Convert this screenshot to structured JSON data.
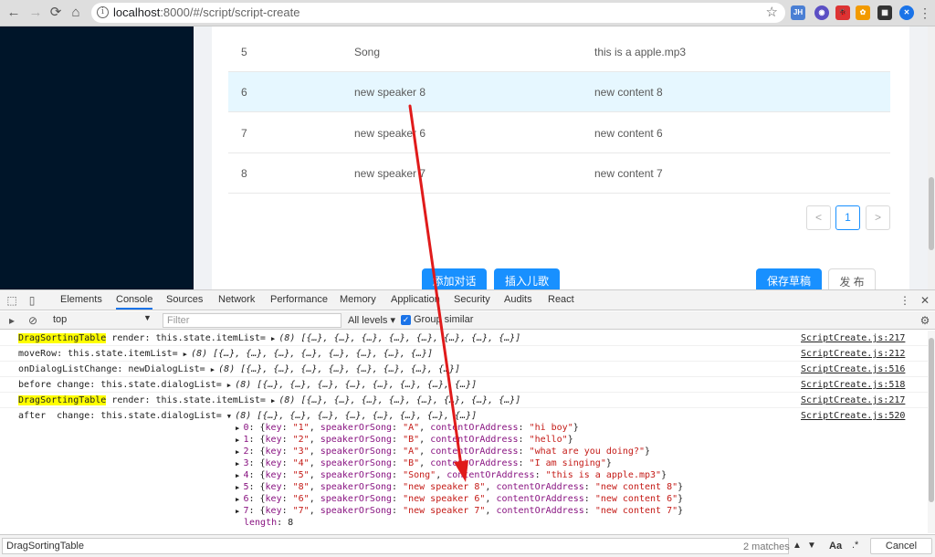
{
  "browser": {
    "back": "←",
    "forward": "→",
    "reload": "⟳",
    "home": "⌂",
    "info": "i",
    "url_host": "localhost",
    "url_rest": ":8000/#/script/script-create",
    "star": "☆",
    "extensions": [
      "JH",
      "◉",
      "🐞",
      "✿",
      "▦",
      "✕"
    ]
  },
  "table": {
    "rows": [
      {
        "key": "5",
        "speaker": "Song",
        "content": "this is a apple.mp3"
      },
      {
        "key": "6",
        "speaker": "new speaker 8",
        "content": "new content 8"
      },
      {
        "key": "7",
        "speaker": "new speaker 6",
        "content": "new content 6"
      },
      {
        "key": "8",
        "speaker": "new speaker 7",
        "content": "new content 7"
      }
    ],
    "pager_prev": "<",
    "pager_page": "1",
    "pager_next": ">"
  },
  "actions": {
    "add_dialog": "添加对话",
    "insert_song": "插入儿歌",
    "save_draft": "保存草稿",
    "publish": "发 布"
  },
  "devtools": {
    "tabs": [
      "Elements",
      "Console",
      "Sources",
      "Network",
      "Performance",
      "Memory",
      "Application",
      "Security",
      "Audits",
      "React"
    ],
    "context": "top",
    "filter_placeholder": "Filter",
    "levels": "All levels",
    "group_similar": "Group similar",
    "logs": [
      {
        "hl": "DragSortingTable",
        "text": " render: this.state.itemList= ",
        "arr": "(8) [{…}, {…}, {…}, {…}, {…}, {…}, {…}, {…}]",
        "src": "ScriptCreate.js:217"
      },
      {
        "hl": "",
        "text": "moveRow: this.state.itemList= ",
        "arr": "(8) [{…}, {…}, {…}, {…}, {…}, {…}, {…}, {…}]",
        "src": "ScriptCreate.js:212"
      },
      {
        "hl": "",
        "text": "onDialogListChange: newDialogList= ",
        "arr": "(8) [{…}, {…}, {…}, {…}, {…}, {…}, {…}, {…}]",
        "src": "ScriptCreate.js:516"
      },
      {
        "hl": "",
        "text": "before change: this.state.dialogList= ",
        "arr": "(8) [{…}, {…}, {…}, {…}, {…}, {…}, {…}, {…}]",
        "src": "ScriptCreate.js:518"
      },
      {
        "hl": "DragSortingTable",
        "text": " render: this.state.itemList= ",
        "arr": "(8) [{…}, {…}, {…}, {…}, {…}, {…}, {…}, {…}]",
        "src": "ScriptCreate.js:217"
      },
      {
        "hl": "",
        "text": "after  change: this.state.dialogList= ",
        "arr": "(8) [{…}, {…}, {…}, {…}, {…}, {…}, {…}, {…}]",
        "src": "ScriptCreate.js:520"
      }
    ],
    "items": [
      {
        "i": "0",
        "key": "\"1\"",
        "sp": "\"A\"",
        "ct": "\"hi boy\""
      },
      {
        "i": "1",
        "key": "\"2\"",
        "sp": "\"B\"",
        "ct": "\"hello\""
      },
      {
        "i": "2",
        "key": "\"3\"",
        "sp": "\"A\"",
        "ct": "\"what are you doing?\""
      },
      {
        "i": "3",
        "key": "\"4\"",
        "sp": "\"B\"",
        "ct": "\"I am singing\""
      },
      {
        "i": "4",
        "key": "\"5\"",
        "sp": "\"Song\"",
        "ct": "\"this is a apple.mp3\""
      },
      {
        "i": "5",
        "key": "\"8\"",
        "sp": "\"new speaker 8\"",
        "ct": "\"new content 8\""
      },
      {
        "i": "6",
        "key": "\"6\"",
        "sp": "\"new speaker 6\"",
        "ct": "\"new content 6\""
      },
      {
        "i": "7",
        "key": "\"7\"",
        "sp": "\"new speaker 7\"",
        "ct": "\"new content 7\""
      }
    ],
    "length_label": "length",
    "length_value": "8",
    "find_query": "DragSortingTable",
    "find_matches": "2 matches",
    "find_case": "Aa",
    "find_regex": ".*",
    "find_cancel": "Cancel"
  }
}
